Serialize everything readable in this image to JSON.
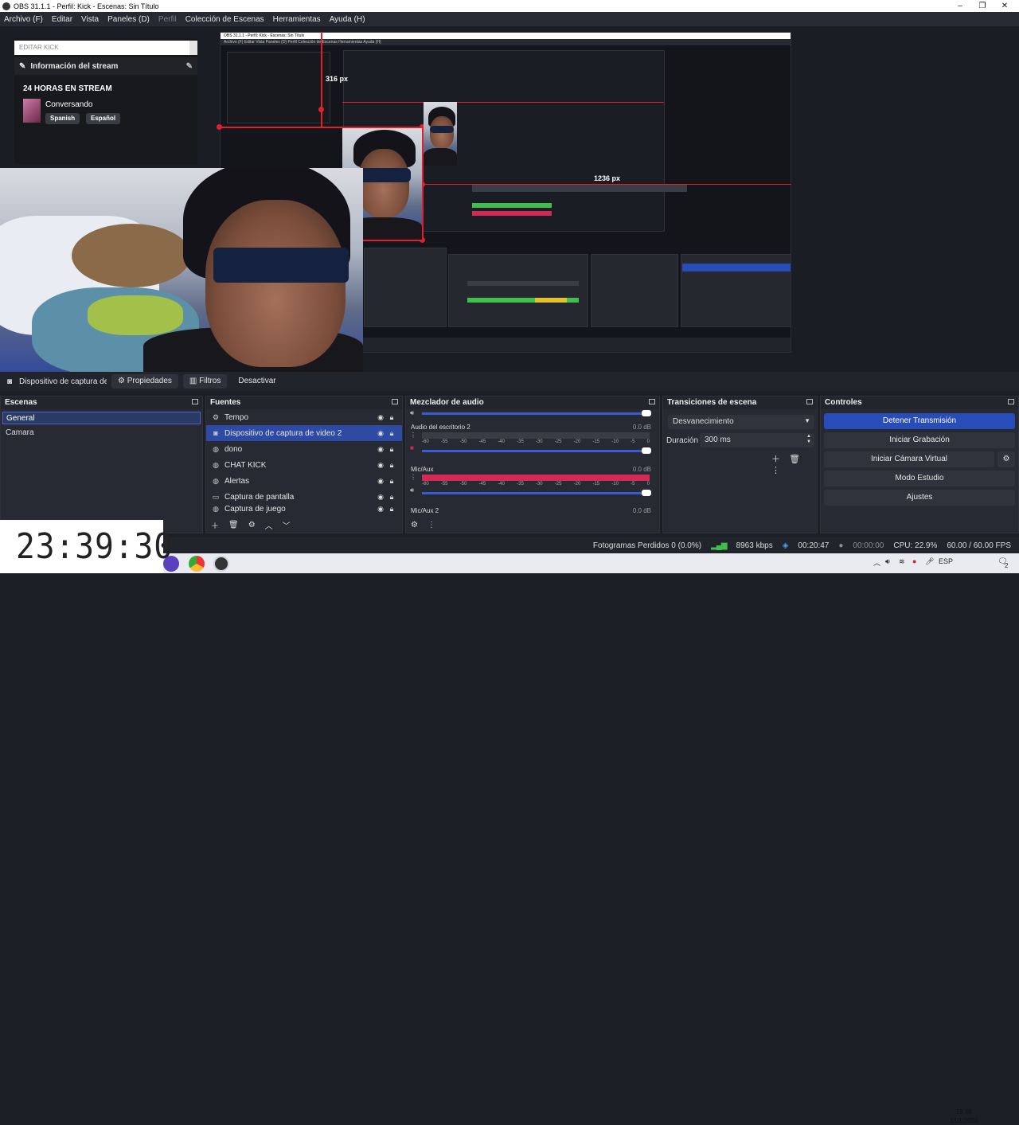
{
  "window": {
    "title": "OBS 31.1.1 - Perfil: Kick - Escenas: Sin Título",
    "controls": [
      "–",
      "❐",
      "✕"
    ]
  },
  "menu": [
    "Archivo (F)",
    "Editar",
    "Vista",
    "Paneles (D)",
    "Perfil",
    "Colección de Escenas",
    "Herramientas",
    "Ayuda (H)"
  ],
  "preview": {
    "kick": {
      "input_placeholder": "EDITAR KICK",
      "header": "Información del stream",
      "title": "24 HORAS EN STREAM",
      "category": "Conversando",
      "tags": [
        "Spanish",
        "Español"
      ]
    },
    "measure_top": "316 px",
    "measure_right": "1236 px",
    "mini_title": "OBS 31.1.1 - Perfil: Kick - Escenas: Sin Título",
    "mini_menu": "Archivo (F)   Editar   Vista   Paneles (D)   Perfil   Colección de Escenas   Herramientas   Ayuda (H)"
  },
  "source_toolbar": {
    "source_name": "Dispositivo de captura de v",
    "properties": "Propiedades",
    "filters": "Filtros",
    "deactivate": "Desactivar"
  },
  "scenes": {
    "title": "Escenas",
    "items": [
      "General",
      "Camara"
    ]
  },
  "sources": {
    "title": "Fuentes",
    "items": [
      {
        "label": "Tempo",
        "icon": "gear-icon"
      },
      {
        "label": "Dispositivo de captura de video 2",
        "icon": "camera-icon"
      },
      {
        "label": "dono",
        "icon": "globe-icon"
      },
      {
        "label": "CHAT KICK",
        "icon": "globe-icon"
      },
      {
        "label": "Alertas",
        "icon": "globe-icon"
      },
      {
        "label": "Captura de pantalla",
        "icon": "monitor-icon"
      },
      {
        "label": "Captura de juego",
        "icon": "gamepad-icon"
      }
    ]
  },
  "mixer": {
    "title": "Mezclador de audio",
    "channels": [
      {
        "name": "Audio del escritorio 2",
        "db": "0.0 dB"
      },
      {
        "name": "Mic/Aux",
        "db": "0.0 dB"
      },
      {
        "name": "Mic/Aux 2",
        "db": "0.0 dB"
      }
    ],
    "ticks": [
      "-60",
      "-55",
      "-50",
      "-45",
      "-40",
      "-35",
      "-30",
      "-25",
      "-20",
      "-15",
      "-10",
      "-5",
      "0"
    ]
  },
  "transitions": {
    "title": "Transiciones de escena",
    "selected": "Desvanecimiento",
    "duration_label": "Duración",
    "duration_value": "300 ms"
  },
  "controls": {
    "title": "Controles",
    "stop_stream": "Detener Transmisión",
    "start_recording": "Iniciar Grabación",
    "start_virtual_cam": "Iniciar Cámara Virtual",
    "studio_mode": "Modo Estudio",
    "settings": "Ajustes"
  },
  "status": {
    "dropped_frames": "Fotogramas Perdidos 0 (0.0%)",
    "bitrate": "8963 kbps",
    "stream_time": "00:20:47",
    "rec_time": "00:00:00",
    "cpu": "CPU: 22.9%",
    "fps": "60.00 / 60.00 FPS"
  },
  "overlay_clock": "23:39:30",
  "taskbar": {
    "lang": "ESP",
    "time": "19:48",
    "date": "1/01/2026",
    "notifications": "2"
  },
  "colors": {
    "accent": "#284cb8",
    "selected_source": "#2e4aa3",
    "measure_line": "#e0202c",
    "meter_green": "#3fbf4c",
    "meter_red": "#d22a55"
  }
}
